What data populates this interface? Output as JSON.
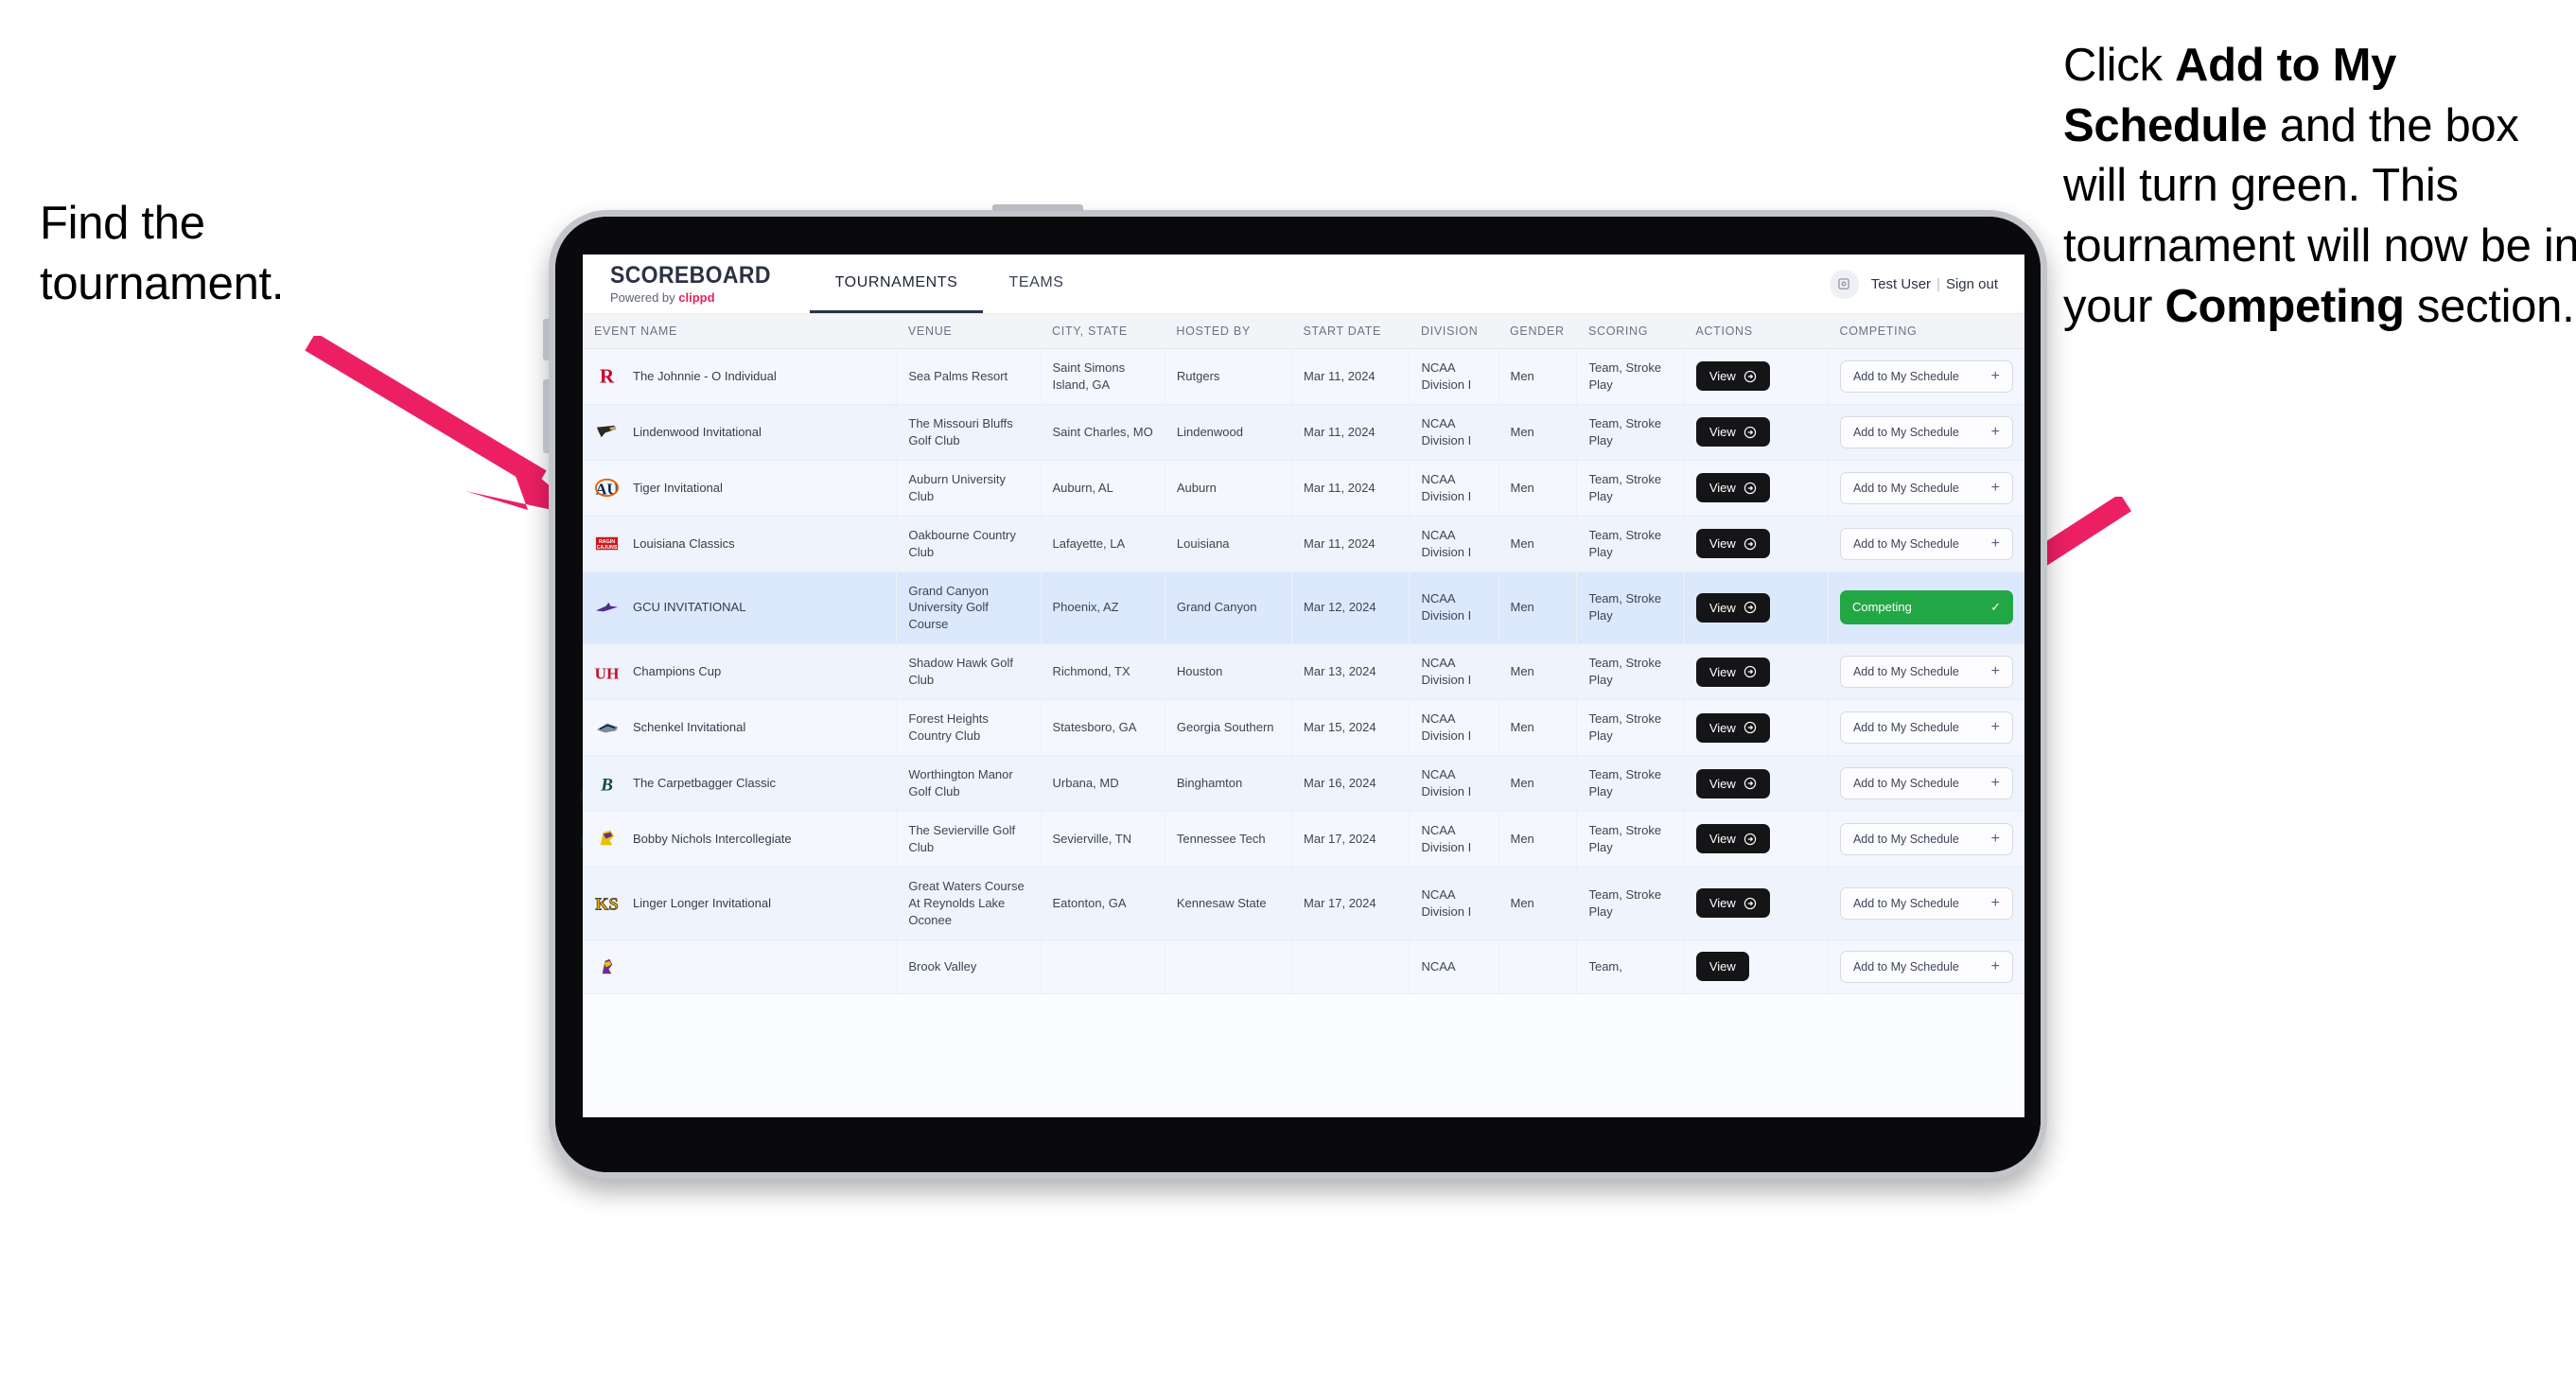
{
  "annotations": {
    "left": {
      "line1": "Find the",
      "line2": "tournament."
    },
    "right": {
      "seg1": "Click ",
      "bold1": "Add to My Schedule",
      "seg2": " and the box will turn green. This tournament will now be in your ",
      "bold2": "Competing",
      "seg3": " section."
    },
    "arrow_color": "#ed1f63"
  },
  "app": {
    "brand": {
      "title": "SCOREBOARD",
      "powered_prefix": "Powered by ",
      "powered_name": "clippd"
    },
    "tabs": [
      {
        "label": "TOURNAMENTS",
        "active": true
      },
      {
        "label": "TEAMS",
        "active": false
      }
    ],
    "user": {
      "name": "Test User",
      "separator": "|",
      "sign_out": "Sign out",
      "avatar_icon": "user-avatar-icon"
    }
  },
  "table": {
    "columns": [
      "EVENT NAME",
      "VENUE",
      "CITY, STATE",
      "HOSTED BY",
      "START DATE",
      "DIVISION",
      "GENDER",
      "SCORING",
      "ACTIONS",
      "COMPETING"
    ],
    "view_label": "View",
    "add_label": "Add to My Schedule",
    "add_plus": "+",
    "competing_label": "Competing",
    "competing_check": "✓",
    "rows": [
      {
        "logo": "rutgers-logo",
        "event": "The Johnnie - O Individual",
        "venue": "Sea Palms Resort",
        "city": "Saint Simons Island, GA",
        "hosted_by": "Rutgers",
        "start_date": "Mar 11, 2024",
        "division": "NCAA Division I",
        "gender": "Men",
        "scoring": "Team, Stroke Play",
        "competing": false
      },
      {
        "logo": "lindenwood-logo",
        "event": "Lindenwood Invitational",
        "venue": "The Missouri Bluffs Golf Club",
        "city": "Saint Charles, MO",
        "hosted_by": "Lindenwood",
        "start_date": "Mar 11, 2024",
        "division": "NCAA Division I",
        "gender": "Men",
        "scoring": "Team, Stroke Play",
        "competing": false
      },
      {
        "logo": "auburn-logo",
        "event": "Tiger Invitational",
        "venue": "Auburn University Club",
        "city": "Auburn, AL",
        "hosted_by": "Auburn",
        "start_date": "Mar 11, 2024",
        "division": "NCAA Division I",
        "gender": "Men",
        "scoring": "Team, Stroke Play",
        "competing": false
      },
      {
        "logo": "louisiana-logo",
        "event": "Louisiana Classics",
        "venue": "Oakbourne Country Club",
        "city": "Lafayette, LA",
        "hosted_by": "Louisiana",
        "start_date": "Mar 11, 2024",
        "division": "NCAA Division I",
        "gender": "Men",
        "scoring": "Team, Stroke Play",
        "competing": false
      },
      {
        "logo": "gcu-logo",
        "event": "GCU INVITATIONAL",
        "venue": "Grand Canyon University Golf Course",
        "city": "Phoenix, AZ",
        "hosted_by": "Grand Canyon",
        "start_date": "Mar 12, 2024",
        "division": "NCAA Division I",
        "gender": "Men",
        "scoring": "Team, Stroke Play",
        "competing": true,
        "selected": true
      },
      {
        "logo": "houston-logo",
        "event": "Champions Cup",
        "venue": "Shadow Hawk Golf Club",
        "city": "Richmond, TX",
        "hosted_by": "Houston",
        "start_date": "Mar 13, 2024",
        "division": "NCAA Division I",
        "gender": "Men",
        "scoring": "Team, Stroke Play",
        "competing": false
      },
      {
        "logo": "georgia-southern-logo",
        "event": "Schenkel Invitational",
        "venue": "Forest Heights Country Club",
        "city": "Statesboro, GA",
        "hosted_by": "Georgia Southern",
        "start_date": "Mar 15, 2024",
        "division": "NCAA Division I",
        "gender": "Men",
        "scoring": "Team, Stroke Play",
        "competing": false
      },
      {
        "logo": "binghamton-logo",
        "event": "The Carpetbagger Classic",
        "venue": "Worthington Manor Golf Club",
        "city": "Urbana, MD",
        "hosted_by": "Binghamton",
        "start_date": "Mar 16, 2024",
        "division": "NCAA Division I",
        "gender": "Men",
        "scoring": "Team, Stroke Play",
        "competing": false
      },
      {
        "logo": "tennessee-tech-logo",
        "event": "Bobby Nichols Intercollegiate",
        "venue": "The Sevierville Golf Club",
        "city": "Sevierville, TN",
        "hosted_by": "Tennessee Tech",
        "start_date": "Mar 17, 2024",
        "division": "NCAA Division I",
        "gender": "Men",
        "scoring": "Team, Stroke Play",
        "competing": false
      },
      {
        "logo": "kennesaw-state-logo",
        "event": "Linger Longer Invitational",
        "venue": "Great Waters Course At Reynolds Lake Oconee",
        "city": "Eatonton, GA",
        "hosted_by": "Kennesaw State",
        "start_date": "Mar 17, 2024",
        "division": "NCAA Division I",
        "gender": "Men",
        "scoring": "Team, Stroke Play",
        "competing": false
      },
      {
        "logo": "partial-logo",
        "event": "",
        "venue": "Brook Valley",
        "city": "",
        "hosted_by": "",
        "start_date": "",
        "division": "NCAA",
        "gender": "",
        "scoring": "Team,",
        "competing": false,
        "partial": true
      }
    ]
  }
}
